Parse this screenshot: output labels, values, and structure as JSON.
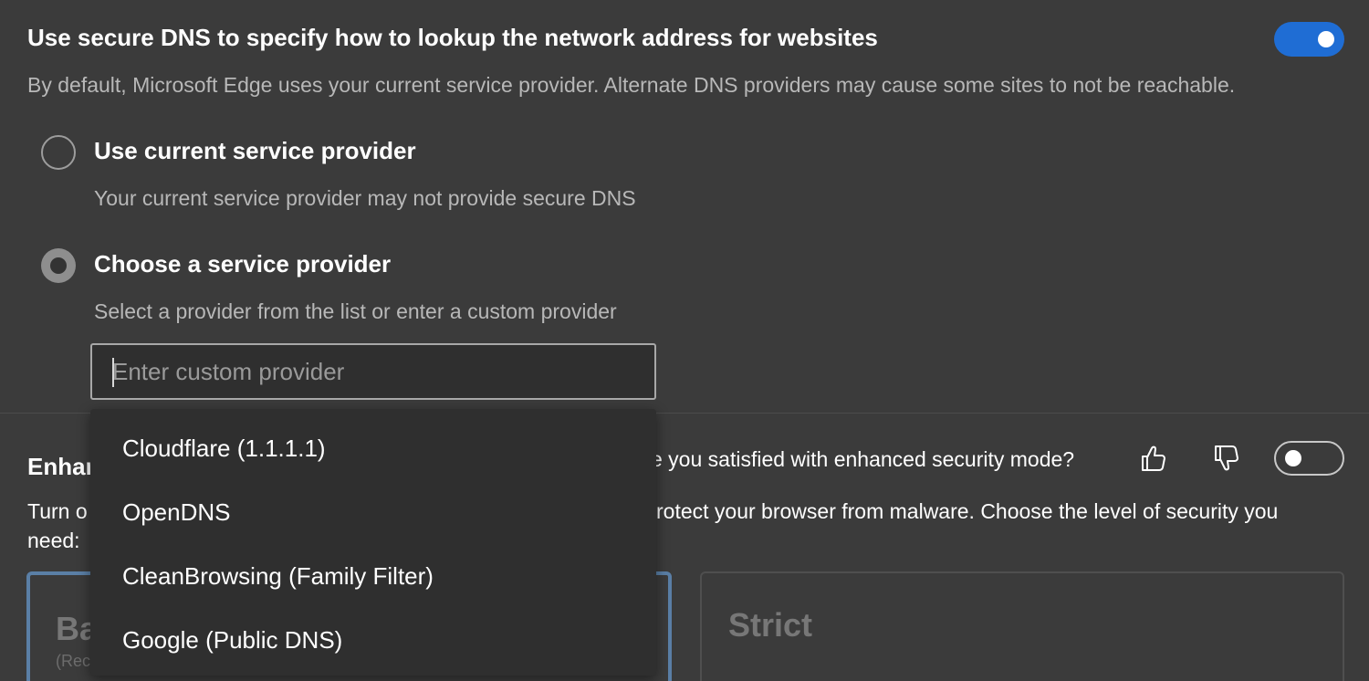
{
  "secure_dns": {
    "title": "Use secure DNS to specify how to lookup the network address for websites",
    "description": "By default, Microsoft Edge uses your current service provider. Alternate DNS providers may cause some sites to not be reachable.",
    "toggle_on": true,
    "accent_color": "#1f6dd4",
    "options": [
      {
        "label": "Use current service provider",
        "description": "Your current service provider may not provide secure DNS",
        "selected": false
      },
      {
        "label": "Choose a service provider",
        "description": "Select a provider from the list or enter a custom provider",
        "selected": true
      }
    ],
    "custom_provider": {
      "value": "",
      "placeholder": "Enter custom provider"
    },
    "dropdown_items": [
      "Cloudflare (1.1.1.1)",
      "OpenDNS",
      "CleanBrowsing (Family Filter)",
      "Google (Public DNS)"
    ]
  },
  "enhanced_security": {
    "title_visible": "Enhan",
    "feedback_question_visible": "e you satisfied with enhanced security mode?",
    "thumbs_up_icon": "thumbs-up-icon",
    "thumbs_down_icon": "thumbs-down-icon",
    "toggle_on": false,
    "description_line1_left": "Turn o",
    "description_line1_right": "rotect your browser from malware. Choose the level of security you",
    "description_line2": "need:",
    "cards": [
      {
        "title_visible": "Ba",
        "subtitle_visible": "(Rec",
        "selected": true
      },
      {
        "title_visible": "Strict",
        "selected": false
      }
    ]
  }
}
